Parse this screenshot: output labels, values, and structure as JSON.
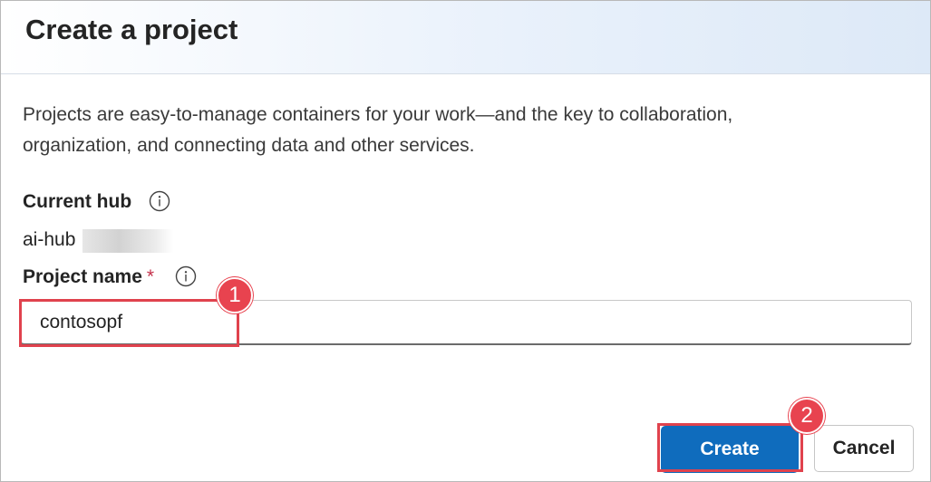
{
  "dialog": {
    "title": "Create a project",
    "description": "Projects are easy-to-manage containers for your work—and the key to collaboration, organization, and connecting data and other services."
  },
  "fields": {
    "current_hub": {
      "label": "Current hub",
      "value": "ai-hub",
      "info_icon": "info-icon"
    },
    "project_name": {
      "label": "Project name",
      "required_marker": "*",
      "value": "contosopf",
      "info_icon": "info-icon"
    }
  },
  "buttons": {
    "create_label": "Create",
    "cancel_label": "Cancel"
  },
  "annotations": {
    "step1": "1",
    "step2": "2",
    "highlight_color": "#e0424d"
  },
  "colors": {
    "primary": "#0f6cbd",
    "required": "#c4314b",
    "header_gradient_end": "#dde9f7"
  }
}
